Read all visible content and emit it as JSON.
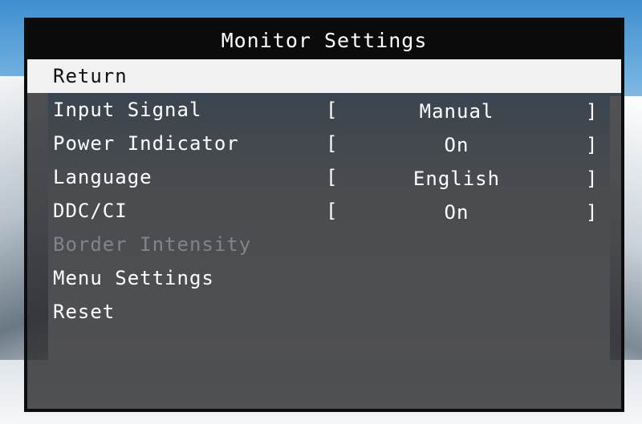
{
  "window": {
    "title": "Monitor Settings"
  },
  "menu": {
    "items": [
      {
        "label": "Return",
        "value": ""
      },
      {
        "label": "Input Signal",
        "value": "Manual"
      },
      {
        "label": "Power Indicator",
        "value": "On"
      },
      {
        "label": "Language",
        "value": "English"
      },
      {
        "label": "DDC/CI",
        "value": "On"
      },
      {
        "label": "Border Intensity",
        "value": ""
      },
      {
        "label": "Menu Settings",
        "value": ""
      },
      {
        "label": "Reset",
        "value": ""
      }
    ],
    "open_bracket": "[",
    "close_bracket": "]"
  },
  "colors": {
    "panel_bg": "#28282a",
    "title_bg": "#0b0b0c",
    "selected_bg": "#f2f2f2",
    "text": "#ffffff",
    "disabled_text": "#7f858a"
  }
}
